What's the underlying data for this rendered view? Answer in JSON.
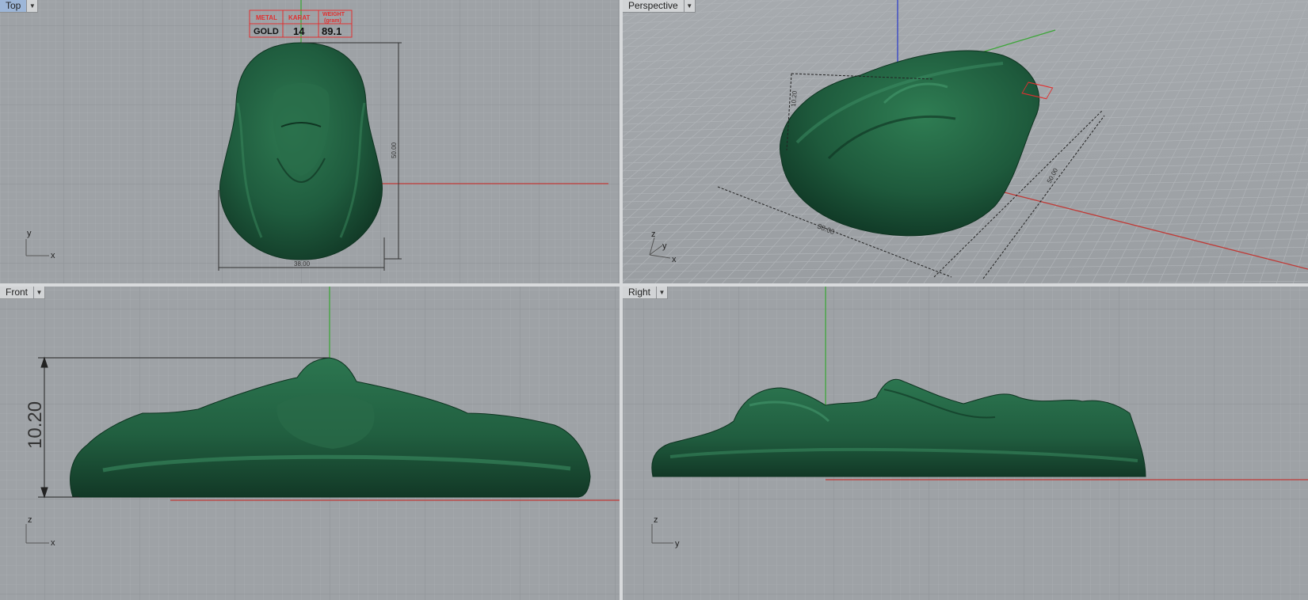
{
  "viewports": {
    "top": {
      "name": "Top"
    },
    "perspective": {
      "name": "Perspective"
    },
    "front": {
      "name": "Front"
    },
    "right": {
      "name": "Right"
    }
  },
  "tag": {
    "headers": [
      "METAL",
      "KARAT",
      "WEIGHT",
      "(gram)"
    ],
    "values": [
      "GOLD",
      "14",
      "89.1"
    ]
  },
  "dimensions": {
    "width": "38.00",
    "height": "50.00",
    "depth": "10.20"
  },
  "axes": {
    "x": "x",
    "y": "y",
    "z": "z"
  },
  "colors": {
    "viewport_bg": "#9ea2a6",
    "grid_minor": "#a7abaf",
    "grid_major": "#8d9196",
    "model": "#1e5a3c",
    "x_axis": "#c03a36",
    "y_axis": "#3ea63a",
    "z_axis": "#3040c8",
    "tag": "#e03030"
  }
}
